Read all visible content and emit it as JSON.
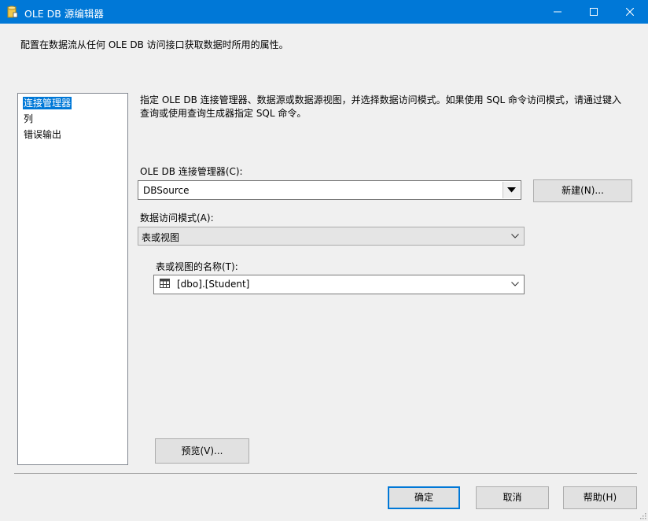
{
  "window": {
    "title": "OLE DB 源编辑器",
    "controls": {
      "minimize": "minimize",
      "maximize": "maximize",
      "close": "close"
    }
  },
  "header": {
    "description": "配置在数据流从任何 OLE DB 访问接口获取数据时所用的属性。"
  },
  "nav": {
    "items": [
      {
        "label": "连接管理器",
        "selected": true
      },
      {
        "label": "列",
        "selected": false
      },
      {
        "label": "错误输出",
        "selected": false
      }
    ]
  },
  "main": {
    "instructions_line1": "指定 OLE DB 连接管理器、数据源或数据源视图，并选择数据访问模式。如果使用 SQL 命令访问模式，请通过键入",
    "instructions_line2": "查询或使用查询生成器指定 SQL 命令。",
    "connection_manager": {
      "label": "OLE DB 连接管理器(C):",
      "value": "DBSource",
      "new_button": "新建(N)..."
    },
    "access_mode": {
      "label": "数据访问模式(A):",
      "value": "表或视图"
    },
    "table_name": {
      "label": "表或视图的名称(T):",
      "value": "[dbo].[Student]"
    },
    "preview_button": "预览(V)..."
  },
  "footer": {
    "ok": "确定",
    "cancel": "取消",
    "help": "帮助(H)"
  },
  "colors": {
    "titlebar": "#0078d7",
    "selection": "#0078d7",
    "background": "#f0f0f0"
  }
}
